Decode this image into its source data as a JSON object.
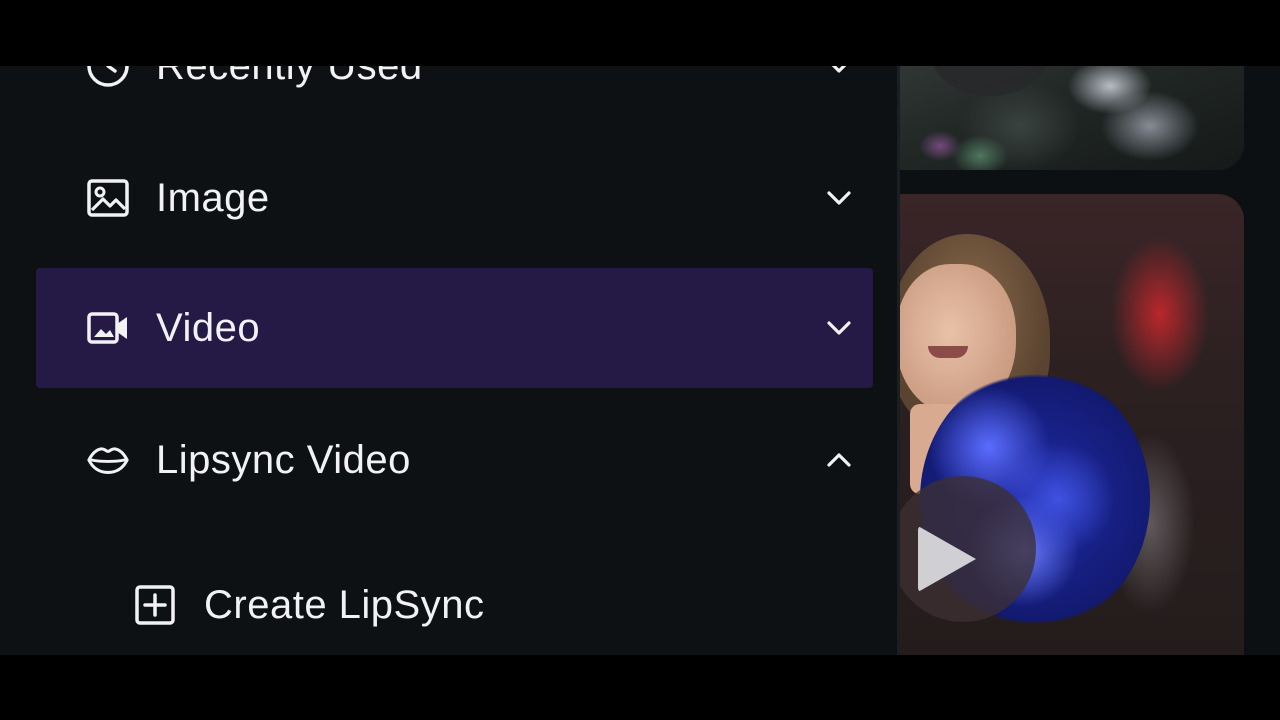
{
  "menu": {
    "items": [
      {
        "label": "Recently Used",
        "icon": "clock-icon",
        "expanded": false,
        "active": false
      },
      {
        "label": "Image",
        "icon": "image-icon",
        "expanded": false,
        "active": false
      },
      {
        "label": "Video",
        "icon": "video-camera-icon",
        "expanded": false,
        "active": true
      },
      {
        "label": "Lipsync Video",
        "icon": "lips-icon",
        "expanded": true,
        "active": false
      }
    ],
    "submenu": [
      {
        "label": "Create LipSync",
        "icon": "plus-square-icon"
      }
    ]
  },
  "colors": {
    "background": "#0d1114",
    "active_item": "#241a45",
    "text": "#f2f2f5"
  }
}
